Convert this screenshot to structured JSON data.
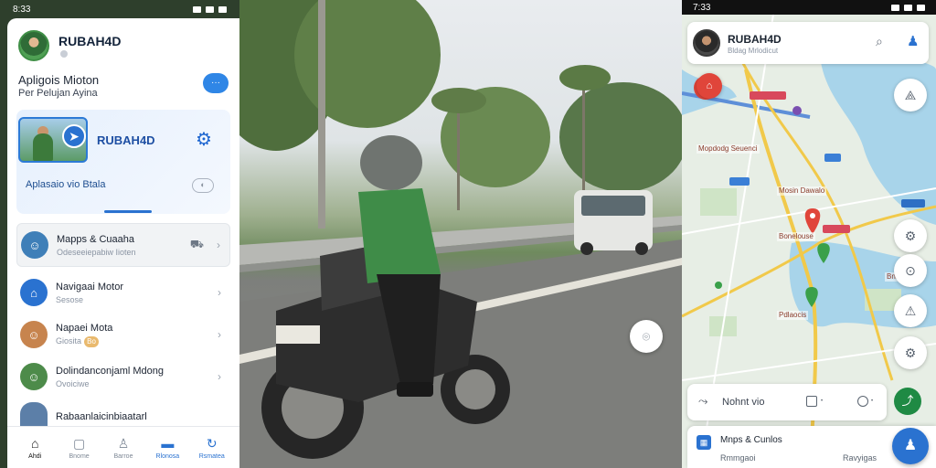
{
  "left_phone": {
    "status_time": "8:33",
    "profile": {
      "name": "RUBAH4D"
    },
    "app_title": "Apligois Mioton",
    "app_subtitle": "Per Pelujan Ayina",
    "chat_button": "···",
    "hero": {
      "brand": "RUBAH4D",
      "action_label": "Aplasaio vio Btala"
    },
    "list": [
      {
        "title": "Mapps & Cuaaha",
        "subtitle": "Odeseeiepabiw Iioten"
      },
      {
        "title": "Navigaai Motor",
        "subtitle": "Sesose"
      },
      {
        "title": "Napaei Mota",
        "subtitle": "Giosita",
        "badge": "Bo"
      },
      {
        "title": "Dolindanconjaml Mdong",
        "subtitle": "Ovoiciwe"
      },
      {
        "title": "Rabaanlaicinbiaatarl"
      }
    ],
    "bottom_nav": [
      {
        "label": "Ahdi",
        "icon": "home-icon"
      },
      {
        "label": "Bnome",
        "icon": "square-icon"
      },
      {
        "label": "Barroe",
        "icon": "person-icon"
      },
      {
        "label": "Rlonosa",
        "icon": "chat-icon"
      },
      {
        "label": "Rsmatea",
        "icon": "refresh-icon"
      }
    ]
  },
  "right_phone": {
    "status_time": "7:33",
    "profile": {
      "name": "RUBAH4D",
      "subtitle": "Bldag Mrlodicut"
    },
    "map_labels": {
      "label_1": "Mopdodg Seuenci",
      "label_2": "Mosin Dawalo",
      "label_3": "Bonelouse",
      "label_4": "Pdlaocis",
      "label_5": "Bnloawvo"
    },
    "route_bar": {
      "label": "Nohnt vio"
    },
    "bottom_sheet": {
      "title": "Mnps & Cunlos",
      "left": "Rmmgaoi",
      "right": "Ravyigas"
    }
  },
  "colors": {
    "accent": "#2a72d0",
    "green": "#1f8a44",
    "marker_red": "#e0453a"
  }
}
